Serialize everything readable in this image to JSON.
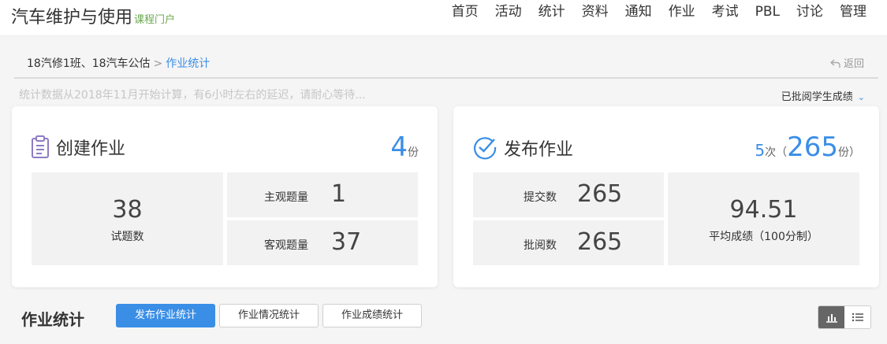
{
  "header": {
    "title": "汽车维护与使用",
    "subtitle": "课程门户",
    "nav": [
      "首页",
      "活动",
      "统计",
      "资料",
      "通知",
      "作业",
      "考试",
      "PBL",
      "讨论",
      "管理"
    ]
  },
  "breadcrumb": {
    "class_name": "18汽修1班、18汽车公估",
    "separator": ">",
    "current": "作业统计",
    "back_label": "返回"
  },
  "notice": "统计数据从2018年11月开始计算，有6小时左右的延迟，请耐心等待...",
  "filter": {
    "label": "已批阅学生成绩"
  },
  "create_card": {
    "title": "创建作业",
    "count": "4",
    "count_unit": "份",
    "total_questions": "38",
    "total_questions_label": "试题数",
    "subjective_label": "主观题量",
    "subjective_value": "1",
    "objective_label": "客观题量",
    "objective_value": "37"
  },
  "publish_card": {
    "title": "发布作业",
    "times": "5",
    "times_unit": "次（",
    "copies": "265",
    "copies_unit": "份）",
    "submit_label": "提交数",
    "submit_value": "265",
    "review_label": "批阅数",
    "review_value": "265",
    "avg_score": "94.51",
    "avg_score_label": "平均成绩（100分制）"
  },
  "stats_section": {
    "title": "作业统计",
    "tabs": [
      "发布作业统计",
      "作业情况统计",
      "作业成绩统计"
    ],
    "active_tab": 0
  },
  "view_toggle": {
    "active": "chart-view",
    "icons": [
      "bar-chart-icon",
      "list-icon"
    ]
  },
  "colors": {
    "accent": "#3a8ee6",
    "brand_sub": "#6aa84f",
    "icon": "#8e7cc3"
  }
}
